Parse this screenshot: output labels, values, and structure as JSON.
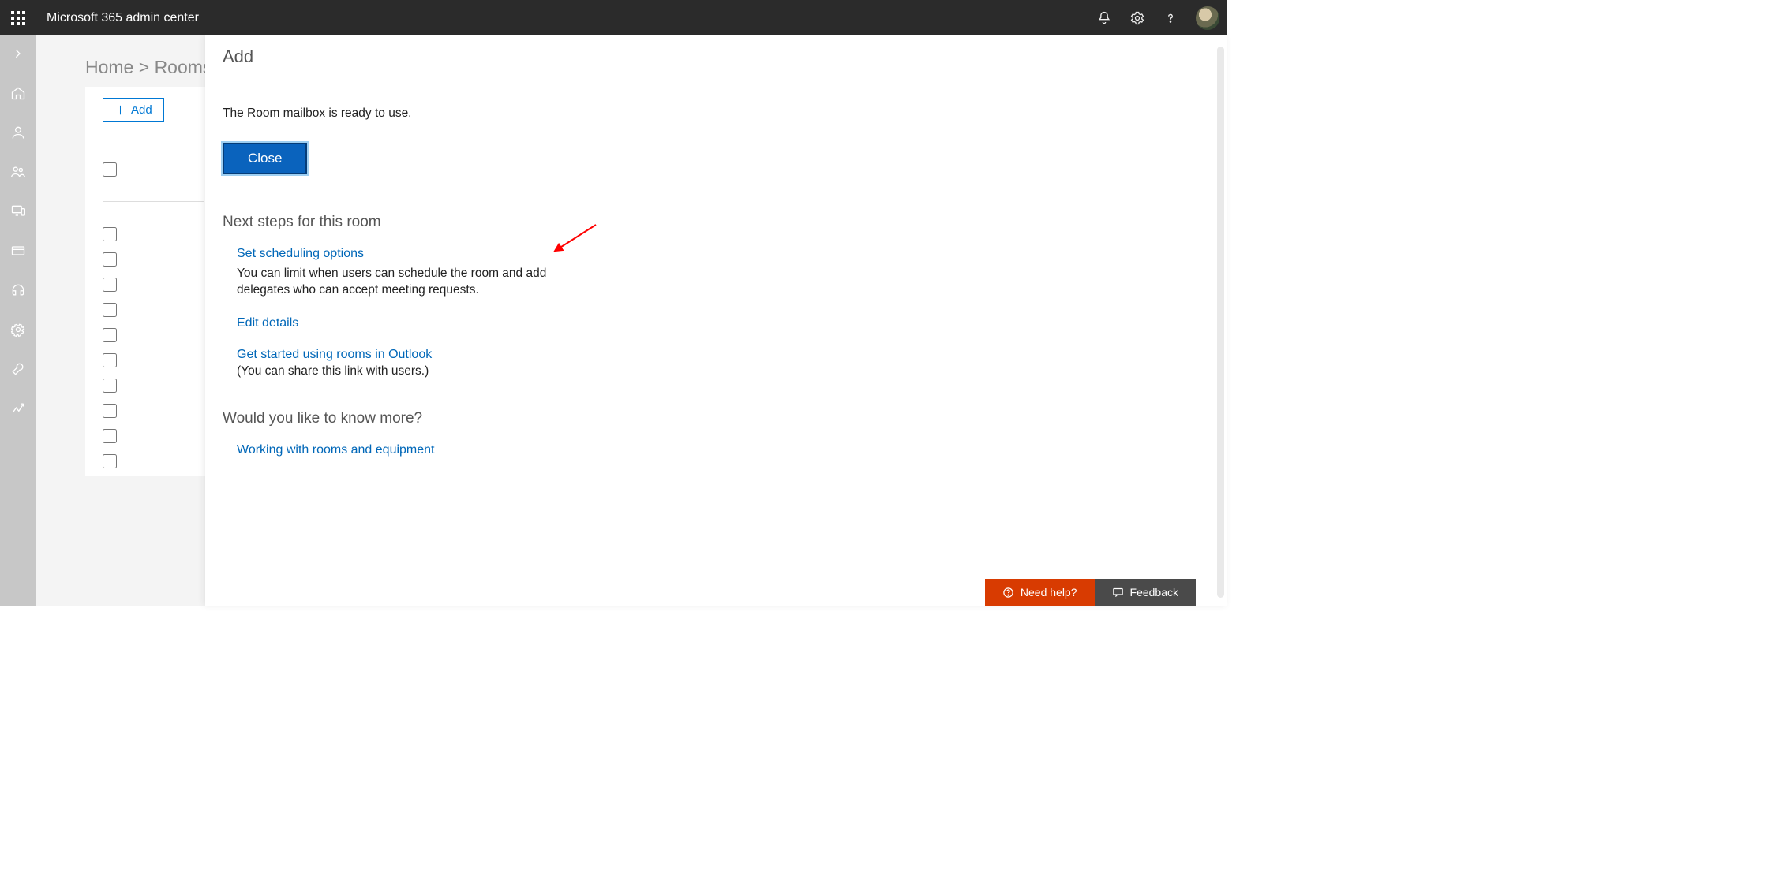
{
  "header": {
    "title": "Microsoft 365 admin center"
  },
  "breadcrumb": "Home > Rooms &",
  "toolbar": {
    "add_label": "Add"
  },
  "panel": {
    "title": "Add",
    "ready_text": "The Room mailbox is ready to use.",
    "close_label": "Close",
    "next_steps_heading": "Next steps for this room",
    "set_scheduling_link": "Set scheduling options",
    "set_scheduling_desc": "You can limit when users can schedule the room and add delegates who can accept meeting requests.",
    "edit_details_link": "Edit details",
    "outlook_link": "Get started using rooms in Outlook",
    "outlook_note": "(You can share this link with users.)",
    "know_more_heading": "Would you like to know more?",
    "working_with_link": "Working with rooms and equipment"
  },
  "bottom": {
    "help_label": "Need help?",
    "feedback_label": "Feedback"
  },
  "list": {
    "checkbox_count": 11
  }
}
